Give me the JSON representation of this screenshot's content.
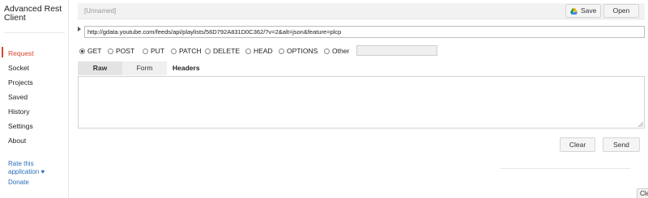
{
  "app": {
    "title": "Advanced Rest Client"
  },
  "sidebar": {
    "items": [
      {
        "label": "Request",
        "active": true
      },
      {
        "label": "Socket"
      },
      {
        "label": "Projects"
      },
      {
        "label": "Saved"
      },
      {
        "label": "History"
      },
      {
        "label": "Settings"
      },
      {
        "label": "About"
      }
    ],
    "rate_label": "Rate this application ♥",
    "donate_label": "Donate"
  },
  "request": {
    "name": "[Unnamed]",
    "save_label": "Save",
    "open_label": "Open",
    "url": "http://gdata.youtube.com/feeds/api/playlists/56D792A831D0C362/?v=2&alt=json&feature=plcp",
    "methods": [
      "GET",
      "POST",
      "PUT",
      "PATCH",
      "DELETE",
      "HEAD",
      "OPTIONS",
      "Other"
    ],
    "selected_method": "GET",
    "other_value": ""
  },
  "tabs": {
    "raw": "Raw",
    "form": "Form",
    "headers": "Headers"
  },
  "headers": {
    "value": ""
  },
  "actions": {
    "clear_label": "Clear",
    "send_label": "Send"
  },
  "corner": {
    "label": "Cle"
  },
  "colors": {
    "accent": "#d8482e",
    "link": "#2a6ebb"
  },
  "icons": {
    "drive": "google-drive-icon",
    "url_toggle": "triangle-right-icon"
  }
}
